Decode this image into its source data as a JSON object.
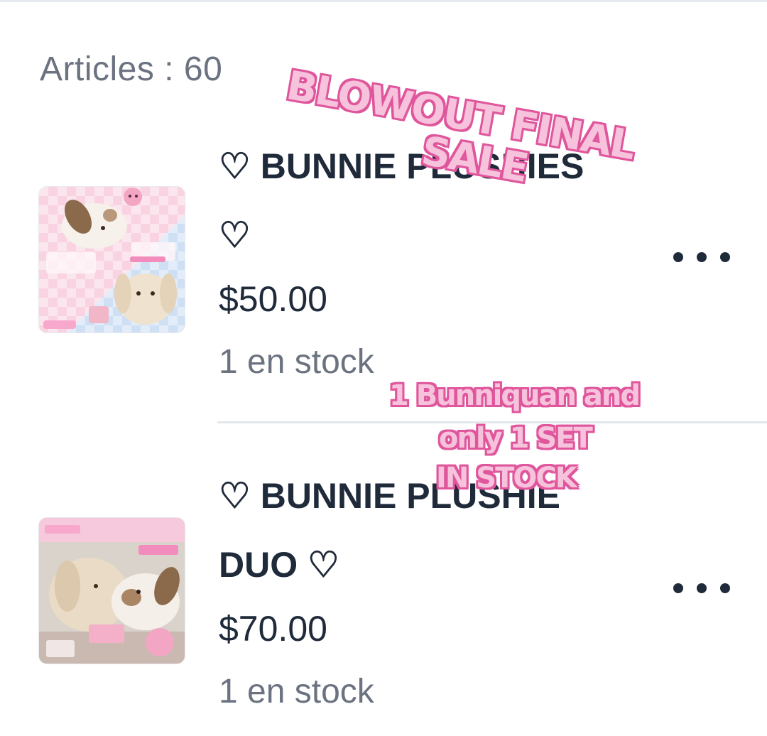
{
  "header": {
    "article_count": "Articles : 60"
  },
  "products": [
    {
      "title": "♡ BUNNIE PLUSHIES ♡",
      "price": "$50.00",
      "stock": "1 en stock",
      "thumbnail": "bunnie-plushies-photo",
      "more_icon": "more-horizontal-icon"
    },
    {
      "title": "♡ BUNNIE PLUSHIE DUO  ♡",
      "price": "$70.00",
      "stock": "1 en stock",
      "thumbnail": "bunnie-plushie-duo-photo",
      "more_icon": "more-horizontal-icon"
    }
  ],
  "stickers": {
    "sale_line1": "BLOWOUT FINAL",
    "sale_line2": "SALE",
    "stock_note_line1": "1 Bunniquan and",
    "stock_note_line2": "only 1 SET",
    "stock_note_line3": "IN STOCK",
    "sticker_fill": "#f7c3dc",
    "sticker_outline": "#e0569c"
  },
  "colors": {
    "text_primary": "#1f2a3a",
    "text_secondary": "#6b7280",
    "divider": "#e3e6ec"
  }
}
